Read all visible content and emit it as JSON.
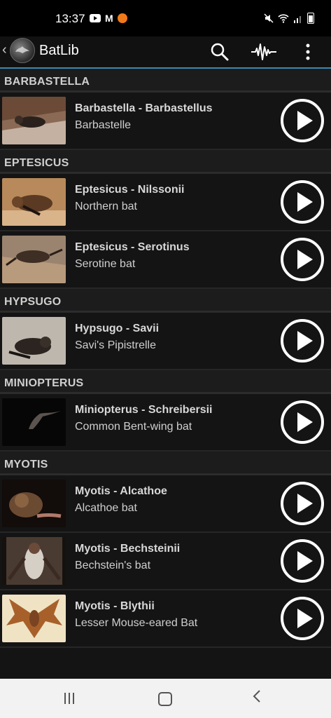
{
  "status_bar": {
    "time": "13:37",
    "mail_icon": "M"
  },
  "app_bar": {
    "title": "BatLib",
    "back_icon": "‹"
  },
  "sections": [
    {
      "header": "BARBASTELLA",
      "items": [
        {
          "title": "Barbastella - Barbastellus",
          "subtitle": "Barbastelle"
        }
      ]
    },
    {
      "header": "EPTESICUS",
      "items": [
        {
          "title": "Eptesicus - Nilssonii",
          "subtitle": "Northern bat"
        },
        {
          "title": "Eptesicus - Serotinus",
          "subtitle": "Serotine bat"
        }
      ]
    },
    {
      "header": "HYPSUGO",
      "items": [
        {
          "title": "Hypsugo - Savii",
          "subtitle": "Savi's Pipistrelle"
        }
      ]
    },
    {
      "header": "MINIOPTERUS",
      "items": [
        {
          "title": "Miniopterus - Schreibersii",
          "subtitle": "Common Bent-wing bat"
        }
      ]
    },
    {
      "header": "MYOTIS",
      "items": [
        {
          "title": "Myotis - Alcathoe",
          "subtitle": "Alcathoe bat"
        },
        {
          "title": "Myotis - Bechsteinii",
          "subtitle": "Bechstein's bat"
        },
        {
          "title": "Myotis - Blythii",
          "subtitle": "Lesser Mouse-eared Bat"
        }
      ]
    }
  ],
  "colors": {
    "accent": "#3a87b0",
    "background": "#101010",
    "section": "#1c1c1c"
  }
}
